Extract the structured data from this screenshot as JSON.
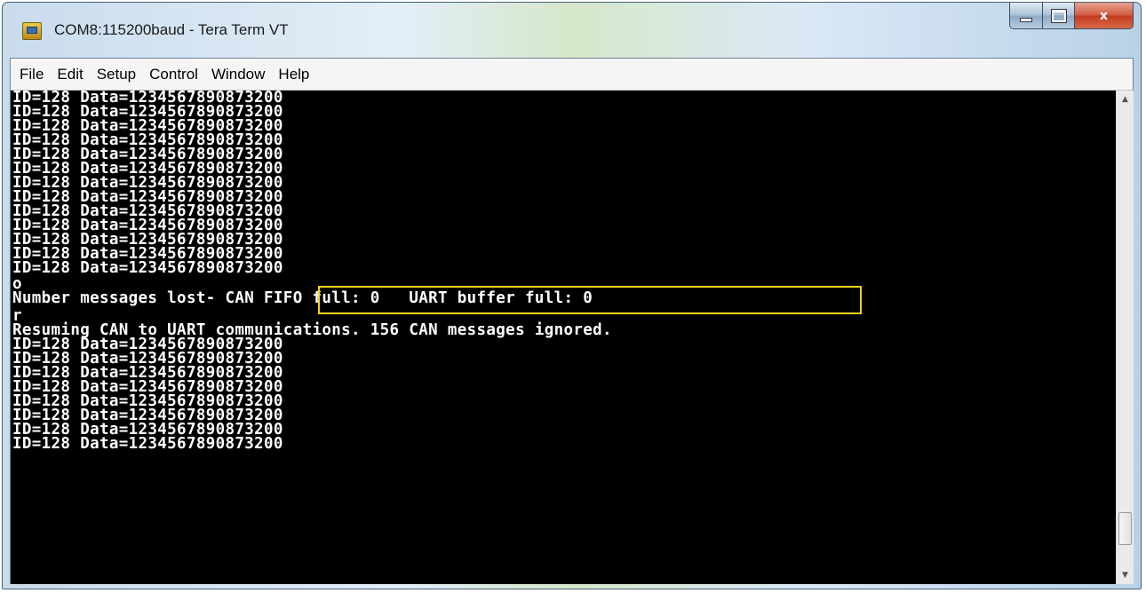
{
  "window": {
    "title": "COM8:115200baud - Tera Term VT",
    "icon": "tera-term-icon",
    "buttons": {
      "minimize": "minimize-icon",
      "maximize": "maximize-icon",
      "close_label": "x"
    }
  },
  "menu": [
    "File",
    "Edit",
    "Setup",
    "Control",
    "Window",
    "Help"
  ],
  "terminal": {
    "lines": [
      "ID=128 Data=1234567890873200",
      "ID=128 Data=1234567890873200",
      "ID=128 Data=1234567890873200",
      "ID=128 Data=1234567890873200",
      "ID=128 Data=1234567890873200",
      "ID=128 Data=1234567890873200",
      "ID=128 Data=1234567890873200",
      "ID=128 Data=1234567890873200",
      "ID=128 Data=1234567890873200",
      "ID=128 Data=1234567890873200",
      "ID=128 Data=1234567890873200",
      "ID=128 Data=1234567890873200",
      "ID=128 Data=1234567890873200",
      "o",
      "Number messages lost- CAN FIFO full: 0   UART buffer full: 0",
      "r",
      "Resuming CAN to UART communications. 156 CAN messages ignored.",
      "ID=128 Data=1234567890873200",
      "ID=128 Data=1234567890873200",
      "ID=128 Data=1234567890873200",
      "ID=128 Data=1234567890873200",
      "ID=128 Data=1234567890873200",
      "ID=128 Data=1234567890873200",
      "ID=128 Data=1234567890873200",
      "ID=128 Data=1234567890873200"
    ],
    "foreground": "#ffffff",
    "background": "#000000",
    "highlight_color": "#f4d21a"
  },
  "scrollbar": {
    "up": "▲",
    "down": "▼"
  }
}
